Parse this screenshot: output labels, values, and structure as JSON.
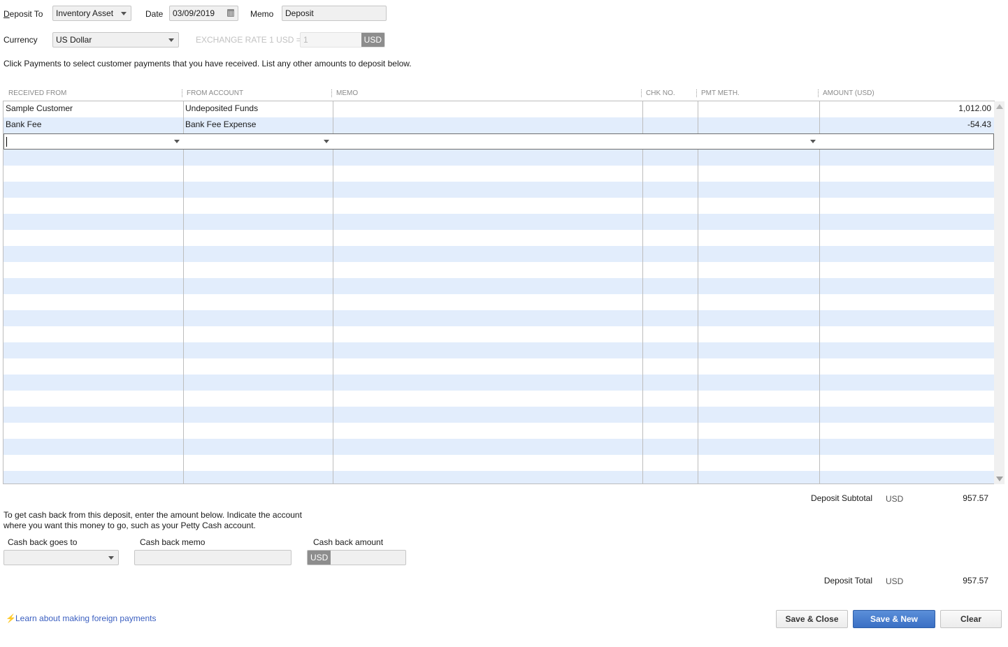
{
  "header": {
    "deposit_to_label": "Deposit To",
    "deposit_to_value": "Inventory Asset",
    "date_label": "Date",
    "date_value": "03/09/2019",
    "memo_label": "Memo",
    "memo_value": "Deposit",
    "currency_label": "Currency",
    "currency_value": "US Dollar",
    "exchange_rate_label": "EXCHANGE RATE 1 USD =",
    "exchange_rate_value": "1",
    "exchange_rate_currency": "USD"
  },
  "instructions": "Click Payments to select customer payments that you have received. List any other amounts to deposit below.",
  "grid": {
    "columns": [
      "RECEIVED FROM",
      "FROM ACCOUNT",
      "MEMO",
      "CHK NO.",
      "PMT METH.",
      "AMOUNT (USD)"
    ],
    "rows": [
      {
        "received_from": "Sample Customer",
        "from_account": "Undeposited Funds",
        "memo": "",
        "chk_no": "",
        "pmt_meth": "",
        "amount": "1,012.00"
      },
      {
        "received_from": "Bank Fee",
        "from_account": "Bank Fee Expense",
        "memo": "",
        "chk_no": "",
        "pmt_meth": "",
        "amount": "-54.43"
      }
    ]
  },
  "totals": {
    "subtotal_label": "Deposit Subtotal",
    "subtotal_currency": "USD",
    "subtotal_value": "957.57",
    "total_label": "Deposit Total",
    "total_currency": "USD",
    "total_value": "957.57"
  },
  "cash_back": {
    "instructions_line1": "To get cash back from this deposit, enter the amount below.  Indicate the account",
    "instructions_line2": "where you want this money to go, such as your Petty Cash account.",
    "goes_to_label": "Cash back goes to",
    "goes_to_value": "",
    "memo_label": "Cash back memo",
    "memo_value": "",
    "amount_label": "Cash back amount",
    "amount_currency": "USD",
    "amount_value": ""
  },
  "footer": {
    "learn_link": "Learn about making foreign payments",
    "save_close_label": "Save & Close",
    "save_new_label": "Save & New",
    "clear_label": "Clear"
  },
  "colors": {
    "row_stripe": "#e2edfc",
    "primary_button": "#3a6fc4",
    "link": "#3b5fc0"
  }
}
